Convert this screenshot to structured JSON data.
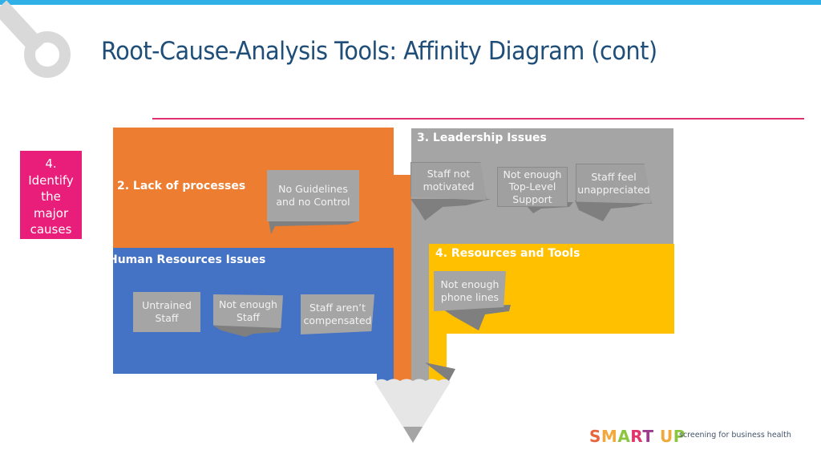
{
  "slide": {
    "title": "Root-Cause-Analysis Tools: Affinity Diagram (cont)",
    "step_badge": {
      "lines": [
        "4.",
        "Identify",
        "the",
        "major",
        "causes"
      ],
      "color": "#e91e7a"
    }
  },
  "diagram": {
    "groups": [
      {
        "id": "processes",
        "label": "2. Lack of processes",
        "color": "#ed7d31",
        "notes": [
          {
            "lines": [
              "No Guidelines",
              "and no Control"
            ]
          }
        ]
      },
      {
        "id": "leadership",
        "label": "3. Leadership Issues",
        "color": "#a5a5a5",
        "notes": [
          {
            "lines": [
              "Staff not",
              "motivated"
            ]
          },
          {
            "lines": [
              "Not enough",
              "Top-Level",
              "Support"
            ]
          },
          {
            "lines": [
              "Staff feel",
              "unappreciated"
            ]
          }
        ]
      },
      {
        "id": "human-resources",
        "label": "Human Resources Issues",
        "color": "#4472c4",
        "notes": [
          {
            "lines": [
              "Untrained",
              "Staff"
            ]
          },
          {
            "lines": [
              "Not enough",
              "Staff"
            ]
          },
          {
            "lines": [
              "Staff aren’t",
              "compensated"
            ]
          }
        ]
      },
      {
        "id": "resources-tools",
        "label": "4. Resources and Tools",
        "color": "#ffc000",
        "notes": [
          {
            "lines": [
              "Not enough",
              "phone lines"
            ]
          }
        ]
      }
    ]
  },
  "footer": {
    "brand_letters": [
      {
        "ch": "S",
        "color": "#e8663d"
      },
      {
        "ch": "M",
        "color": "#f2a93b"
      },
      {
        "ch": "A",
        "color": "#8cc63f"
      },
      {
        "ch": "R",
        "color": "#e2336b"
      },
      {
        "ch": "T",
        "color": "#9b3b8c"
      },
      {
        "ch": " ",
        "color": "#ffffff"
      },
      {
        "ch": "U",
        "color": "#f2a93b"
      },
      {
        "ch": "P",
        "color": "#8cc63f"
      }
    ],
    "tagline": "screening for business health"
  },
  "colors": {
    "top_bar": "#2fb0e6",
    "title": "#1f4e79",
    "rule": "#e0306f"
  }
}
